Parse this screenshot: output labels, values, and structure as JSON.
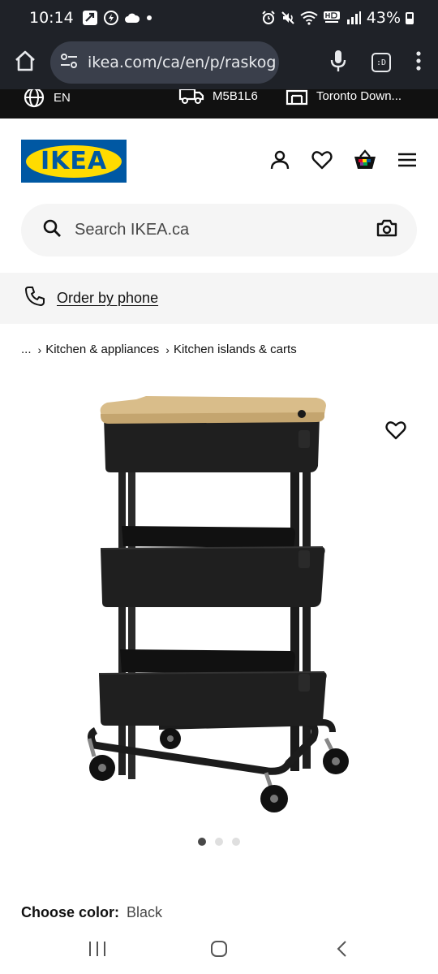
{
  "status_bar": {
    "time": "10:14",
    "battery": "43%",
    "left_icons": [
      "data-saver-icon",
      "whatsapp-icon",
      "cloud-icon",
      "dot-icon"
    ],
    "right_icons": [
      "alarm-icon",
      "mute-icon",
      "wifi-icon",
      "hd-voice-icon",
      "signal-icon",
      "battery-icon"
    ]
  },
  "browser": {
    "url": "ikea.com/ca/en/p/raskog",
    "tab_count": ":D"
  },
  "top_strip": {
    "language": "EN",
    "postal_code": "M5B1L6",
    "store": "Toronto Down..."
  },
  "header": {
    "logo_text": "IKEA"
  },
  "search": {
    "placeholder": "Search IKEA.ca"
  },
  "phone_bar": {
    "label": "Order by phone"
  },
  "breadcrumb": {
    "ellipsis": "...",
    "items": [
      "Kitchen & appliances",
      "Kitchen islands & carts"
    ]
  },
  "gallery": {
    "image_count": 3,
    "active_index": 0
  },
  "product": {
    "color_label": "Choose color:",
    "color_value": "Black"
  },
  "colors": {
    "ikea_blue": "#0058a3",
    "ikea_yellow": "#ffdb00",
    "cart_black": "#1c1c1c",
    "wood_top": "#d9bd8a"
  }
}
